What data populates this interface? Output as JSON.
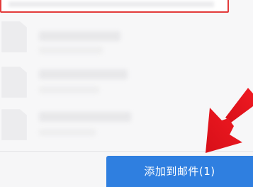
{
  "file_list": {
    "rows": [
      {
        "icon": "file-icon"
      },
      {
        "icon": "file-icon"
      },
      {
        "icon": "file-icon"
      }
    ]
  },
  "footer": {
    "add_button_label": "添加到邮件(1)"
  },
  "colors": {
    "accent_button": "#2f7fe0",
    "highlight_border": "#e33b3b",
    "annotation_arrow": "#e8141c"
  }
}
